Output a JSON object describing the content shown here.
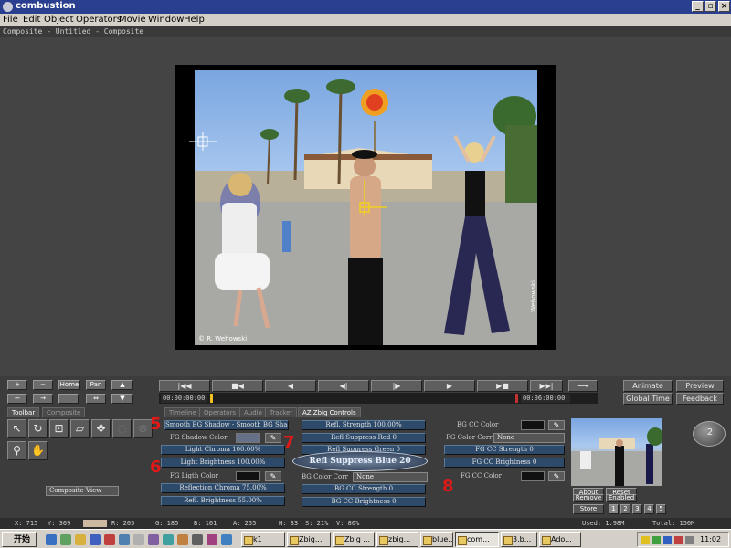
{
  "window": {
    "title": "combustion",
    "buttons": [
      "_",
      "▫",
      "×"
    ]
  },
  "menu": [
    "File",
    "Edit",
    "Object",
    "Operators",
    "Movie",
    "Window",
    "Help"
  ],
  "breadcrumb": "Composite - Untitled - Composite",
  "image": {
    "credit": "© R. Wehowski",
    "signature": "Wehowski"
  },
  "small_buttons": {
    "plus": "+",
    "minus": "−",
    "home": "Home",
    "pan": "Pan",
    "left": "←",
    "right": "→"
  },
  "transport": {
    "time_start": "00:00:00:00",
    "time_end": "00:06:00:00"
  },
  "side_buttons": {
    "animate": "Animate",
    "preview": "Preview",
    "global_time": "Global Time",
    "feedback": "Feedback"
  },
  "tabs": [
    "Toolbar",
    "Composite",
    "Timeline",
    "Operators",
    "Audio",
    "Tracker",
    "AZ Zbig Controls"
  ],
  "params": {
    "smooth_bg_shadow": "Smooth BG Shadow - Smooth BG Shad",
    "fg_shadow_color": "FG Shadow Color",
    "light_chroma": "Light Chroma 100.00%",
    "light_brightness": "Light Brightness 100.00%",
    "fg_light_color": "FG Ligth Color",
    "reflection_chroma": "Reflection Chroma 75.00%",
    "refl_brightness": "Refl. Brightness 55.00%",
    "refl_strength": "Refl. Strength 100.00%",
    "refl_suppress_red": "Refl Suppress Red 0",
    "refl_suppress_green": "Refl Suppress Green 0",
    "refl_suppress_blue": "Refl Suppress Blue 20",
    "bg_color_corr_label": "BG Color Corr",
    "bg_color_corr_value": "None",
    "bg_cc_strength": "BG CC Strength 0",
    "bg_cc_brightness": "BG CC Brightness 0",
    "bg_cc_color": "BG CC Color",
    "fg_color_corr_label": "FG Color Corr",
    "fg_color_corr_value": "None",
    "fg_cc_strength": "FG CC Strength 0",
    "fg_cc_brightness": "FG CC Brightness 0",
    "fg_cc_color": "FG CC Color"
  },
  "annotations": [
    "5",
    "6",
    "7",
    "8"
  ],
  "composite_view": "Composite View",
  "thumb_buttons": {
    "about": "About",
    "reset": "Reset",
    "remove": "Remove",
    "enabled": "Enabled",
    "store": "Store",
    "slots": [
      "1",
      "2",
      "3",
      "4",
      "5"
    ]
  },
  "dial_value": "2",
  "status": {
    "x": "X:   715",
    "y": "Y:   369",
    "r": "R: 205",
    "g": "G: 185",
    "b": "B: 161",
    "a": "A: 255",
    "h": "H: 33",
    "s": "S: 21%",
    "v": "V: 80%",
    "used": "Used: 1.98M",
    "total": "Total: 156M"
  },
  "taskbar": {
    "start": "开始",
    "tasks": [
      "k1",
      "Zbig...",
      "Zbig ...",
      "zbig...",
      "blue...",
      "com...",
      "3.b...",
      "Ado..."
    ],
    "clock": "11:02"
  },
  "colors": {
    "accent": "#2a3f8f",
    "param_button": "#2d4a6a",
    "annotation": "#e01818",
    "status_swatch": "#cdb9a1"
  }
}
